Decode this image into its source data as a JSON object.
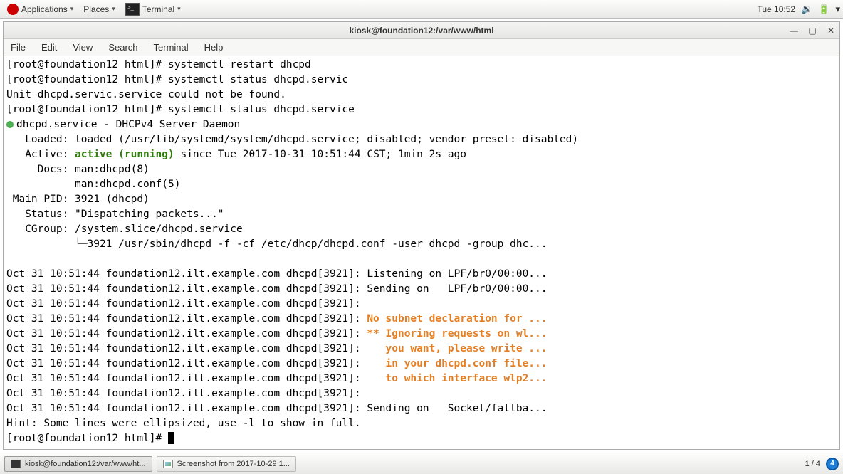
{
  "top_panel": {
    "applications": "Applications",
    "places": "Places",
    "terminal": "Terminal",
    "clock": "Tue 10:52"
  },
  "window": {
    "title": "kiosk@foundation12:/var/www/html",
    "menus": {
      "file": "File",
      "edit": "Edit",
      "view": "View",
      "search": "Search",
      "terminal": "Terminal",
      "help": "Help"
    }
  },
  "terminal": {
    "lines": [
      {
        "t": "plain",
        "text": "[root@foundation12 html]# systemctl restart dhcpd"
      },
      {
        "t": "plain",
        "text": "[root@foundation12 html]# systemctl status dhcpd.servic"
      },
      {
        "t": "plain",
        "text": "Unit dhcpd.servic.service could not be found."
      },
      {
        "t": "plain",
        "text": "[root@foundation12 html]# systemctl status dhcpd.service"
      },
      {
        "t": "dot",
        "text": "dhcpd.service - DHCPv4 Server Daemon"
      },
      {
        "t": "plain",
        "text": "   Loaded: loaded (/usr/lib/systemd/system/dhcpd.service; disabled; vendor preset: disabled)"
      },
      {
        "t": "active",
        "pre": "   Active: ",
        "green": "active (running)",
        "post": " since Tue 2017-10-31 10:51:44 CST; 1min 2s ago"
      },
      {
        "t": "plain",
        "text": "     Docs: man:dhcpd(8)"
      },
      {
        "t": "plain",
        "text": "           man:dhcpd.conf(5)"
      },
      {
        "t": "plain",
        "text": " Main PID: 3921 (dhcpd)"
      },
      {
        "t": "plain",
        "text": "   Status: \"Dispatching packets...\""
      },
      {
        "t": "plain",
        "text": "   CGroup: /system.slice/dhcpd.service"
      },
      {
        "t": "plain",
        "text": "           └─3921 /usr/sbin/dhcpd -f -cf /etc/dhcp/dhcpd.conf -user dhcpd -group dhc..."
      },
      {
        "t": "blank"
      },
      {
        "t": "plain",
        "text": "Oct 31 10:51:44 foundation12.ilt.example.com dhcpd[3921]: Listening on LPF/br0/00:00..."
      },
      {
        "t": "plain",
        "text": "Oct 31 10:51:44 foundation12.ilt.example.com dhcpd[3921]: Sending on   LPF/br0/00:00..."
      },
      {
        "t": "plain",
        "text": "Oct 31 10:51:44 foundation12.ilt.example.com dhcpd[3921]: "
      },
      {
        "t": "warn",
        "pre": "Oct 31 10:51:44 foundation12.ilt.example.com dhcpd[3921]: ",
        "orange": "No subnet declaration for ..."
      },
      {
        "t": "warn",
        "pre": "Oct 31 10:51:44 foundation12.ilt.example.com dhcpd[3921]: ",
        "orange": "** Ignoring requests on wl..."
      },
      {
        "t": "warn",
        "pre": "Oct 31 10:51:44 foundation12.ilt.example.com dhcpd[3921]:    ",
        "orange": "you want, please write ..."
      },
      {
        "t": "warn",
        "pre": "Oct 31 10:51:44 foundation12.ilt.example.com dhcpd[3921]:    ",
        "orange": "in your dhcpd.conf file..."
      },
      {
        "t": "warn",
        "pre": "Oct 31 10:51:44 foundation12.ilt.example.com dhcpd[3921]:    ",
        "orange": "to which interface wlp2..."
      },
      {
        "t": "plain",
        "text": "Oct 31 10:51:44 foundation12.ilt.example.com dhcpd[3921]: "
      },
      {
        "t": "plain",
        "text": "Oct 31 10:51:44 foundation12.ilt.example.com dhcpd[3921]: Sending on   Socket/fallba..."
      },
      {
        "t": "plain",
        "text": "Hint: Some lines were ellipsized, use -l to show in full."
      },
      {
        "t": "prompt",
        "text": "[root@foundation12 html]# "
      }
    ]
  },
  "bottom_panel": {
    "task1": "kiosk@foundation12:/var/www/ht...",
    "task2": "Screenshot from 2017-10-29 1...",
    "workspace_label": "1 / 4",
    "workspace_badge": "4"
  }
}
